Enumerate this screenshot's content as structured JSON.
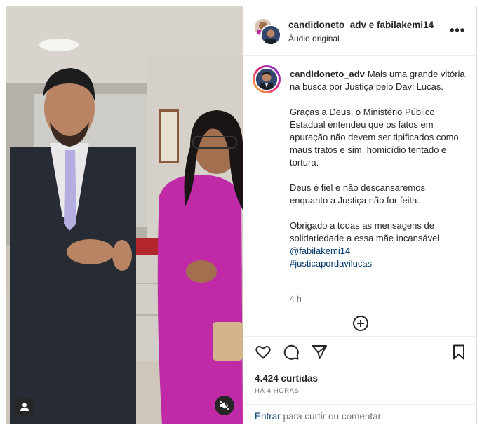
{
  "header": {
    "title": "candidoneto_adv e fabilakemi14",
    "subtitle": "Áudio original"
  },
  "caption": {
    "username": "candidoneto_adv",
    "p1": "Mais uma grande vitória na busca por Justiça pelo Davi Lucas.",
    "p2": "Graças a Deus, o Ministério Público Estadual entendeu que os fatos em apuração não devem ser tipificados como maus tratos e sim, homicídio tentado e tortura.",
    "p3": "Deus é fiel e não descansaremos enquanto a Justiça não for feita.",
    "p4": "Obrigado a todas as mensagens de solidariedade a essa mãe incansável",
    "mention": "@fabilakemi14",
    "hashtag": "#justicapordavilucas",
    "time": "4 h"
  },
  "stats": {
    "likes": "4.424 curtidas",
    "ago": "HÁ 4 HORAS"
  },
  "comment": {
    "login_link": "Entrar",
    "rest": "para curtir ou comentar."
  },
  "icons": {
    "more": "more-options-icon",
    "add": "add-comment-icon",
    "like": "heart-icon",
    "comment": "comment-icon",
    "share": "paper-plane-icon",
    "save": "bookmark-icon",
    "user_tag": "user-tag-icon",
    "mute": "muted-speaker-icon"
  }
}
